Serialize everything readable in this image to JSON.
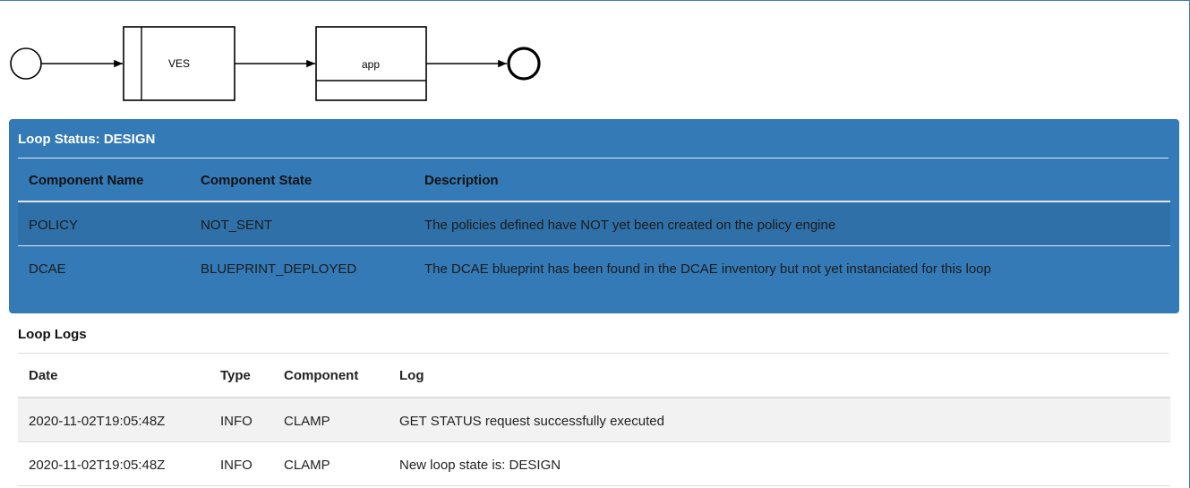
{
  "diagram": {
    "nodes": [
      {
        "id": "start-event",
        "label": ""
      },
      {
        "id": "ves-task",
        "label": "VES"
      },
      {
        "id": "app-task",
        "label": "app"
      },
      {
        "id": "end-event",
        "label": ""
      }
    ]
  },
  "loop_status": {
    "title": "Loop Status: DESIGN",
    "headers": [
      "Component Name",
      "Component State",
      "Description"
    ],
    "rows": [
      [
        "POLICY",
        "NOT_SENT",
        "The policies defined have NOT yet been created on the policy engine"
      ],
      [
        "DCAE",
        "BLUEPRINT_DEPLOYED",
        "The DCAE blueprint has been found in the DCAE inventory but not yet instanciated for this loop"
      ]
    ],
    "panel_color": "#337ab7"
  },
  "loop_logs": {
    "title": "Loop Logs",
    "headers": [
      "Date",
      "Type",
      "Component",
      "Log"
    ],
    "rows": [
      [
        "2020-11-02T19:05:48Z",
        "INFO",
        "CLAMP",
        "GET STATUS request successfully executed"
      ],
      [
        "2020-11-02T19:05:48Z",
        "INFO",
        "CLAMP",
        "New loop state is: DESIGN"
      ]
    ]
  }
}
